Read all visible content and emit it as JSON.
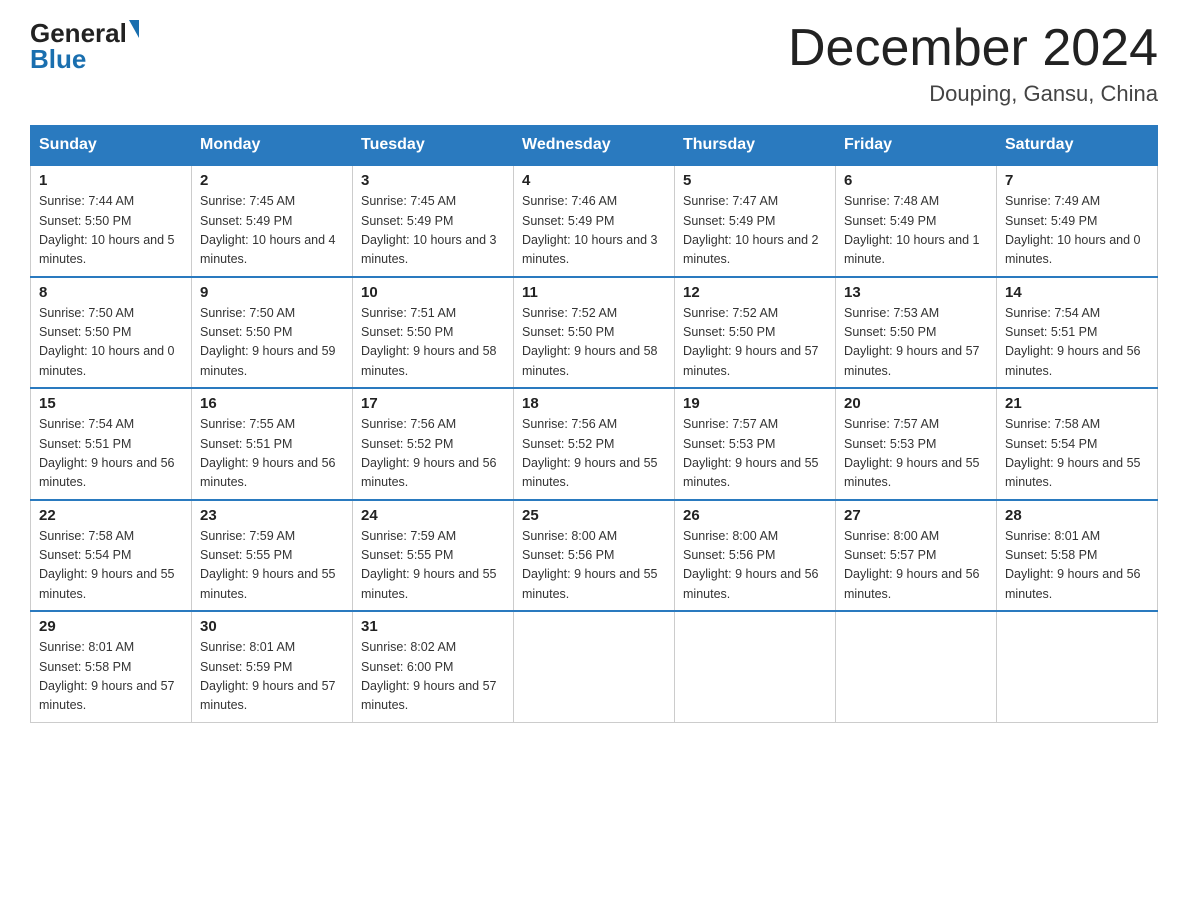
{
  "header": {
    "logo_general": "General",
    "logo_blue": "Blue",
    "month_title": "December 2024",
    "location": "Douping, Gansu, China"
  },
  "weekdays": [
    "Sunday",
    "Monday",
    "Tuesday",
    "Wednesday",
    "Thursday",
    "Friday",
    "Saturday"
  ],
  "weeks": [
    [
      {
        "day": "1",
        "sunrise": "7:44 AM",
        "sunset": "5:50 PM",
        "daylight": "10 hours and 5 minutes."
      },
      {
        "day": "2",
        "sunrise": "7:45 AM",
        "sunset": "5:49 PM",
        "daylight": "10 hours and 4 minutes."
      },
      {
        "day": "3",
        "sunrise": "7:45 AM",
        "sunset": "5:49 PM",
        "daylight": "10 hours and 3 minutes."
      },
      {
        "day": "4",
        "sunrise": "7:46 AM",
        "sunset": "5:49 PM",
        "daylight": "10 hours and 3 minutes."
      },
      {
        "day": "5",
        "sunrise": "7:47 AM",
        "sunset": "5:49 PM",
        "daylight": "10 hours and 2 minutes."
      },
      {
        "day": "6",
        "sunrise": "7:48 AM",
        "sunset": "5:49 PM",
        "daylight": "10 hours and 1 minute."
      },
      {
        "day": "7",
        "sunrise": "7:49 AM",
        "sunset": "5:49 PM",
        "daylight": "10 hours and 0 minutes."
      }
    ],
    [
      {
        "day": "8",
        "sunrise": "7:50 AM",
        "sunset": "5:50 PM",
        "daylight": "10 hours and 0 minutes."
      },
      {
        "day": "9",
        "sunrise": "7:50 AM",
        "sunset": "5:50 PM",
        "daylight": "9 hours and 59 minutes."
      },
      {
        "day": "10",
        "sunrise": "7:51 AM",
        "sunset": "5:50 PM",
        "daylight": "9 hours and 58 minutes."
      },
      {
        "day": "11",
        "sunrise": "7:52 AM",
        "sunset": "5:50 PM",
        "daylight": "9 hours and 58 minutes."
      },
      {
        "day": "12",
        "sunrise": "7:52 AM",
        "sunset": "5:50 PM",
        "daylight": "9 hours and 57 minutes."
      },
      {
        "day": "13",
        "sunrise": "7:53 AM",
        "sunset": "5:50 PM",
        "daylight": "9 hours and 57 minutes."
      },
      {
        "day": "14",
        "sunrise": "7:54 AM",
        "sunset": "5:51 PM",
        "daylight": "9 hours and 56 minutes."
      }
    ],
    [
      {
        "day": "15",
        "sunrise": "7:54 AM",
        "sunset": "5:51 PM",
        "daylight": "9 hours and 56 minutes."
      },
      {
        "day": "16",
        "sunrise": "7:55 AM",
        "sunset": "5:51 PM",
        "daylight": "9 hours and 56 minutes."
      },
      {
        "day": "17",
        "sunrise": "7:56 AM",
        "sunset": "5:52 PM",
        "daylight": "9 hours and 56 minutes."
      },
      {
        "day": "18",
        "sunrise": "7:56 AM",
        "sunset": "5:52 PM",
        "daylight": "9 hours and 55 minutes."
      },
      {
        "day": "19",
        "sunrise": "7:57 AM",
        "sunset": "5:53 PM",
        "daylight": "9 hours and 55 minutes."
      },
      {
        "day": "20",
        "sunrise": "7:57 AM",
        "sunset": "5:53 PM",
        "daylight": "9 hours and 55 minutes."
      },
      {
        "day": "21",
        "sunrise": "7:58 AM",
        "sunset": "5:54 PM",
        "daylight": "9 hours and 55 minutes."
      }
    ],
    [
      {
        "day": "22",
        "sunrise": "7:58 AM",
        "sunset": "5:54 PM",
        "daylight": "9 hours and 55 minutes."
      },
      {
        "day": "23",
        "sunrise": "7:59 AM",
        "sunset": "5:55 PM",
        "daylight": "9 hours and 55 minutes."
      },
      {
        "day": "24",
        "sunrise": "7:59 AM",
        "sunset": "5:55 PM",
        "daylight": "9 hours and 55 minutes."
      },
      {
        "day": "25",
        "sunrise": "8:00 AM",
        "sunset": "5:56 PM",
        "daylight": "9 hours and 55 minutes."
      },
      {
        "day": "26",
        "sunrise": "8:00 AM",
        "sunset": "5:56 PM",
        "daylight": "9 hours and 56 minutes."
      },
      {
        "day": "27",
        "sunrise": "8:00 AM",
        "sunset": "5:57 PM",
        "daylight": "9 hours and 56 minutes."
      },
      {
        "day": "28",
        "sunrise": "8:01 AM",
        "sunset": "5:58 PM",
        "daylight": "9 hours and 56 minutes."
      }
    ],
    [
      {
        "day": "29",
        "sunrise": "8:01 AM",
        "sunset": "5:58 PM",
        "daylight": "9 hours and 57 minutes."
      },
      {
        "day": "30",
        "sunrise": "8:01 AM",
        "sunset": "5:59 PM",
        "daylight": "9 hours and 57 minutes."
      },
      {
        "day": "31",
        "sunrise": "8:02 AM",
        "sunset": "6:00 PM",
        "daylight": "9 hours and 57 minutes."
      },
      null,
      null,
      null,
      null
    ]
  ]
}
